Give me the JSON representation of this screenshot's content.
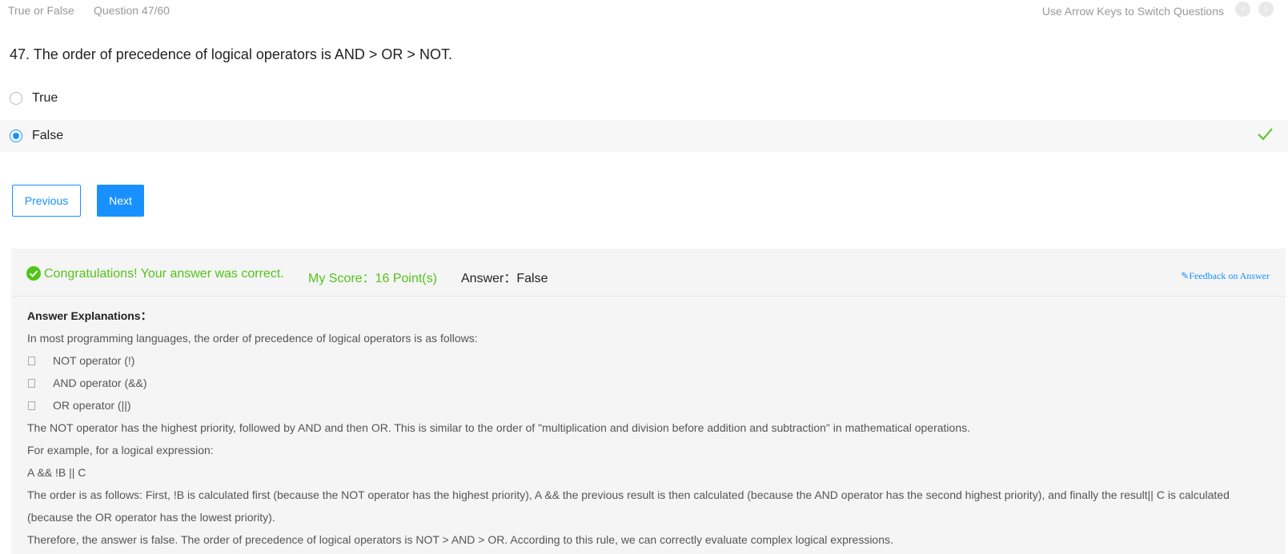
{
  "topbar": {
    "type_label": "True or False",
    "question_counter": "Question 47/60",
    "hint": "Use Arrow Keys to Switch Questions",
    "prev_icon": "chevron-left-icon",
    "next_icon": "chevron-right-icon"
  },
  "question": {
    "text": "47. The order of precedence of logical operators is AND > OR > NOT."
  },
  "options": [
    {
      "label": "True",
      "selected": false
    },
    {
      "label": "False",
      "selected": true,
      "correct": true
    }
  ],
  "buttons": {
    "previous": "Previous",
    "next": "Next"
  },
  "result": {
    "congrats": "Congratulations! Your answer was correct.",
    "score": "My Score：16 Point(s)",
    "answer": "Answer：False",
    "feedback": "Feedback on Answer",
    "success_color": "#52c41a",
    "accent_color": "#1890ff"
  },
  "explanation": {
    "heading": "Answer Explanations：",
    "intro": "In most programming languages, the order of precedence of logical operators is as follows:",
    "bullets": [
      "NOT operator (!)",
      "AND operator (&&)",
      "OR operator (||)"
    ],
    "para1": "The NOT operator has the highest priority, followed by AND and then OR. This is similar to the order of \"multiplication and division before addition and subtraction\" in mathematical operations.",
    "para2": "For example, for a logical expression:",
    "expression": "A && !B || C",
    "para3": "The order is as follows: First, !B is calculated first (because the NOT operator has the highest priority), A && the previous result is then calculated (because the AND operator has the second highest priority), and finally the result|| C is calculated (because the OR operator has the lowest priority).",
    "para4": "Therefore, the answer is false. The order of precedence of logical operators is NOT > AND > OR. According to this rule, we can correctly evaluate complex logical expressions."
  }
}
